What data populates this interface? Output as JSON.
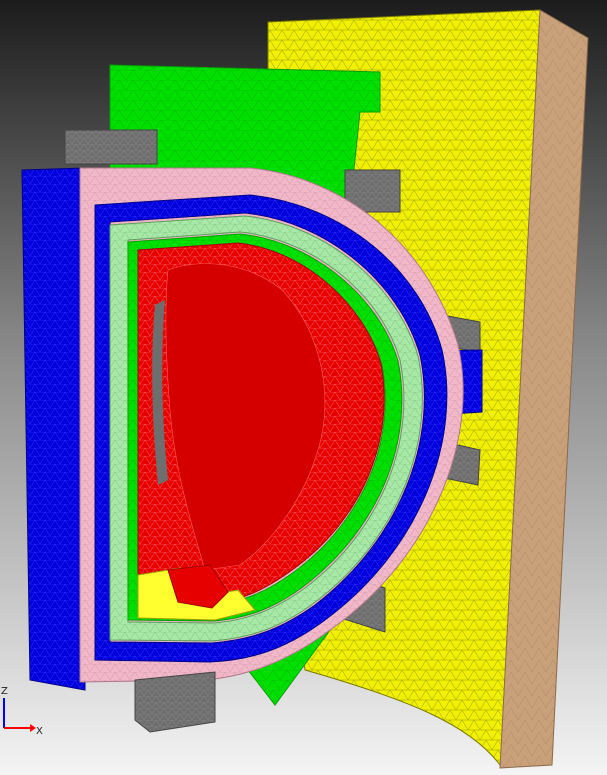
{
  "colors": {
    "background_top": "#1c1c1c",
    "background_bottom": "#f4f4f4",
    "plasma_red": "#e60000",
    "plasma_mesh_line": "#ff6a6a",
    "first_wall_green": "#00e000",
    "first_wall_light_green": "#a8e8a8",
    "vessel_blue": "#0000dd",
    "pink_shell": "#f0b8c8",
    "outer_yellow": "#f0f000",
    "yellow_mesh_line": "#9c9c00",
    "edge_tan": "#c8a07a",
    "support_gray": "#6e6e6e",
    "divertor_yellow": "#ffff30",
    "axis_z": "#0000ff",
    "axis_x": "#ff0000"
  },
  "axes_triad": {
    "z_label": "Z",
    "x_label": "X"
  }
}
